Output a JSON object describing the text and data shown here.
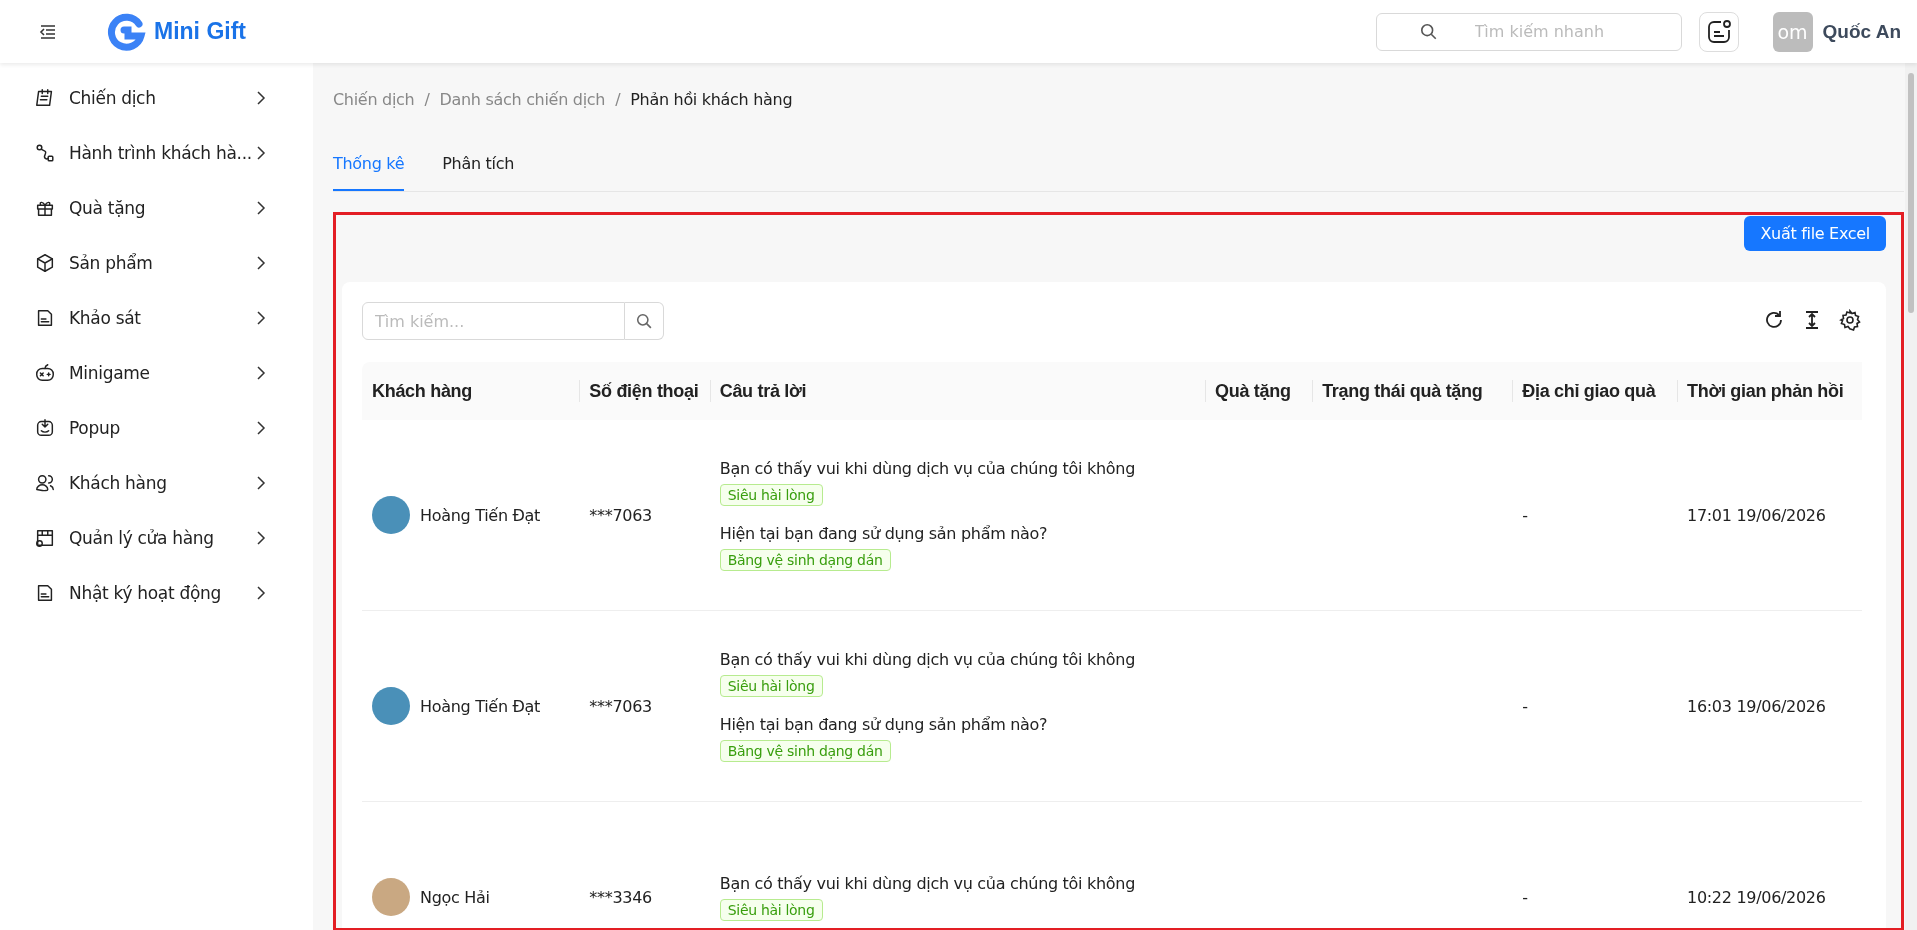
{
  "header": {
    "brand": "Mini Gift",
    "search": {
      "placeholder": "Tìm kiếm nhanh"
    },
    "user": {
      "avatar_text": "om",
      "name": "Quốc An"
    }
  },
  "sidebar": {
    "items": [
      {
        "label": "Chiến dịch"
      },
      {
        "label": "Hành trình khách hà..."
      },
      {
        "label": "Quà tặng"
      },
      {
        "label": "Sản phẩm"
      },
      {
        "label": "Khảo sát"
      },
      {
        "label": "Minigame"
      },
      {
        "label": "Popup"
      },
      {
        "label": "Khách hàng"
      },
      {
        "label": "Quản lý cửa hàng"
      },
      {
        "label": "Nhật ký hoạt động"
      }
    ]
  },
  "breadcrumb": [
    {
      "kind": "link",
      "label": "Chiến dịch"
    },
    {
      "kind": "separator",
      "label": "/"
    },
    {
      "kind": "link",
      "label": "Danh sách chiến dịch"
    },
    {
      "kind": "separator",
      "label": "/"
    },
    {
      "kind": "current",
      "label": "Phản hồi khách hàng"
    }
  ],
  "tabs": [
    {
      "label": "Thống kê",
      "selected": true
    },
    {
      "label": "Phân tích",
      "selected": false
    }
  ],
  "export_button": "Xuất file Excel",
  "table": {
    "search": {
      "placeholder": "Tìm kiếm..."
    },
    "columns": [
      "Khách hàng",
      "Số điện thoại",
      "Câu trả lời",
      "Quà tặng",
      "Trạng thái quà tặng",
      "Địa chỉ giao quà",
      "Thời gian phản hồi"
    ],
    "rows": [
      {
        "customer": "Hoàng Tiến Đạt",
        "phone": "***7063",
        "answers": [
          {
            "question": "Bạn có thấy vui khi dùng dịch vụ của chúng tôi không",
            "answer": "Siêu hài lòng"
          },
          {
            "question": "Hiện tại bạn đang sử dụng sản phẩm nào?",
            "answer": "Băng vệ sinh dạng dán"
          }
        ],
        "address": "-",
        "time": "17:01 19/06/2026"
      },
      {
        "customer": "Hoàng Tiến Đạt",
        "phone": "***7063",
        "answers": [
          {
            "question": "Bạn có thấy vui khi dùng dịch vụ của chúng tôi không",
            "answer": "Siêu hài lòng"
          },
          {
            "question": "Hiện tại bạn đang sử dụng sản phẩm nào?",
            "answer": "Băng vệ sinh dạng dán"
          }
        ],
        "address": "-",
        "time": "16:03 19/06/2026"
      },
      {
        "customer": "Ngọc Hải",
        "phone": "***3346",
        "answers": [
          {
            "question": "Bạn có thấy vui khi dùng dịch vụ của chúng tôi không",
            "answer": "Siêu hài lòng"
          }
        ],
        "address": "-",
        "time": "10:22 19/06/2026"
      }
    ]
  }
}
